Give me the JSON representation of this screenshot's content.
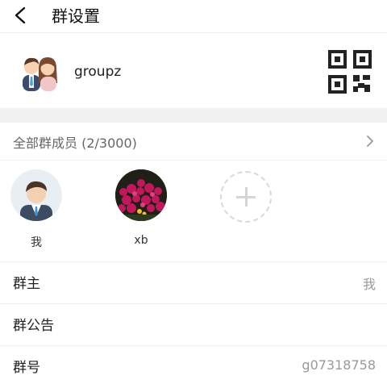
{
  "header": {
    "title": "群设置"
  },
  "group": {
    "name": "groupz"
  },
  "members": {
    "label": "全部群成员 (2/3000)",
    "list": [
      {
        "name": "我"
      },
      {
        "name": "xb"
      }
    ]
  },
  "rows": [
    {
      "label": "群主",
      "value": "我"
    },
    {
      "label": "群公告",
      "value": ""
    },
    {
      "label": "群号",
      "value": "g07318758"
    }
  ]
}
